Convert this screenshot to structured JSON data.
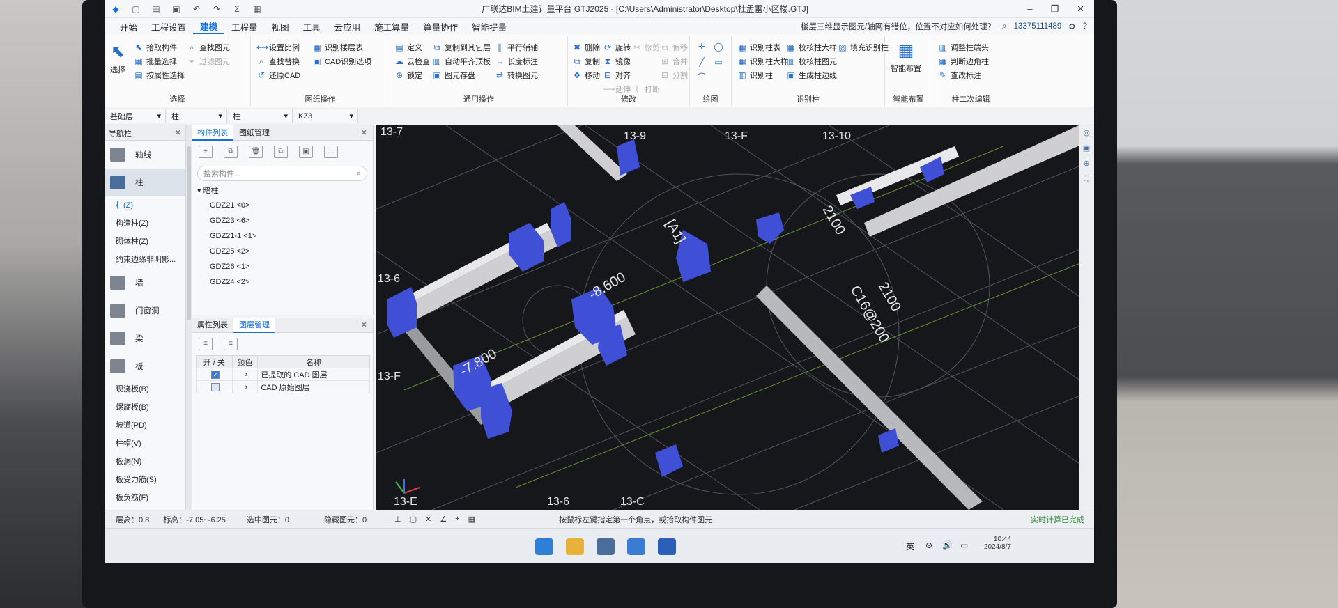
{
  "title": "广联达BIM土建计量平台 GTJ2025 - [C:\\Users\\Administrator\\Desktop\\杜孟雷小区楼.GTJ]",
  "menu": [
    "开始",
    "工程设置",
    "建模",
    "工程量",
    "视图",
    "工具",
    "云应用",
    "施工算量",
    "算量协作",
    "智能提量"
  ],
  "question": "楼层三维显示图元/轴网有错位，位置不对应如何处理？",
  "account": "13375111489",
  "ribbon": {
    "select": {
      "big": "选择",
      "items": [
        "拾取构件",
        "批量选择",
        "按属性选择",
        "查找图元",
        "过滤图元"
      ],
      "label": "选择"
    },
    "drawing": {
      "items": [
        "设置比例",
        "查找替换",
        "还原CAD",
        "识别楼层表",
        "CAD识别选项"
      ],
      "label": "图纸操作"
    },
    "common": {
      "items": [
        "定义",
        "云检查",
        "锁定",
        "复制到其它层",
        "自动平齐顶板",
        "图元存盘",
        "平行辅轴",
        "长度标注",
        "转换图元"
      ],
      "label": "通用操作"
    },
    "modify": {
      "items": [
        "删除",
        "复制",
        "移动",
        "旋转",
        "镜像",
        "对齐",
        "修剪",
        "延伸",
        "打断",
        "偏移",
        "合并",
        "分割"
      ],
      "label": "修改"
    },
    "draw": {
      "label": "绘图"
    },
    "recog": {
      "items": [
        "识别柱表",
        "识别柱大样",
        "识别柱",
        "校核柱大样",
        "校核柱图元",
        "生成柱边线",
        "填充识别柱"
      ],
      "label": "识别柱"
    },
    "smart": {
      "big": "智能布置",
      "label": "智能布置"
    },
    "col2": {
      "items": [
        "调整柱端头",
        "判断边角柱",
        "查改标注"
      ],
      "label": "柱二次编辑"
    }
  },
  "combos": [
    "基础层",
    "柱",
    "柱",
    "KZ3"
  ],
  "nav": {
    "title": "导航栏",
    "big": [
      "轴线",
      "柱",
      "墙",
      "门窗洞",
      "梁",
      "板"
    ],
    "col_subs": [
      "柱(Z)",
      "构造柱(Z)",
      "砌体柱(Z)",
      "约束边缘非阴影..."
    ],
    "slab_subs": [
      "现浇板(B)",
      "螺旋板(B)",
      "坡道(PD)",
      "柱帽(V)",
      "板洞(N)",
      "板受力筋(S)",
      "板负筋(F)"
    ]
  },
  "comp": {
    "tabs": [
      "构件列表",
      "图纸管理"
    ],
    "search": "搜索构件...",
    "root": "暗柱",
    "items": [
      "GDZ21 <0>",
      "GDZ23 <6>",
      "GDZ21-1 <1>",
      "GDZ25 <2>",
      "GDZ26 <1>",
      "GDZ24 <2>"
    ]
  },
  "attr": {
    "tabs": [
      "属性列表",
      "图层管理"
    ],
    "headers": [
      "开 / 关",
      "颜色",
      "名称"
    ],
    "rows": [
      "已提取的 CAD 图层",
      "CAD 原始图层"
    ]
  },
  "viewport": {
    "axes": [
      "13-7",
      "13-9",
      "13-F",
      "13-10",
      "13-6",
      "13-F",
      "13-E",
      "13-6",
      "13-C"
    ],
    "dims": [
      "-8.600",
      "-7.800",
      "2100",
      "2100",
      "C16@200"
    ],
    "label": "[A1]"
  },
  "status": {
    "floor_h": "层高：0.8",
    "elev": "标高：-7.05~-6.25",
    "selected": "选中图元：0",
    "hidden": "隐藏图元：0",
    "hint": "按鼠标左键指定第一个角点，或拾取构件图元",
    "calc": "实时计算已完成"
  },
  "tray": {
    "ime": "英",
    "time": "10:44",
    "date": "2024/8/7"
  }
}
